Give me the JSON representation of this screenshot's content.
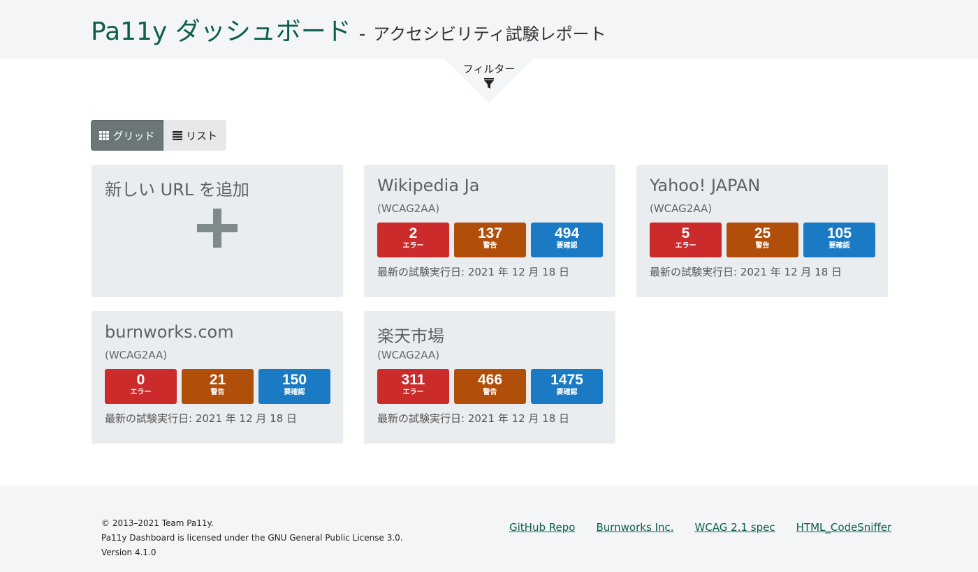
{
  "header": {
    "title": "Pa11y ダッシュボード",
    "separator": "-",
    "subtitle": "アクセシビリティ試験レポート"
  },
  "filter": {
    "label": "フィルター",
    "icon": "filter-icon"
  },
  "view_toggle": {
    "grid_label": "グリッド",
    "list_label": "リスト",
    "active": "grid"
  },
  "add_card": {
    "title": "新しい URL を追加",
    "icon": "plus-icon"
  },
  "stat_labels": {
    "errors": "エラー",
    "warnings": "警告",
    "notices": "要確認"
  },
  "sites": [
    {
      "name": "Wikipedia Ja",
      "standard": "(WCAG2AA)",
      "errors": "2",
      "warnings": "137",
      "notices": "494",
      "last_run": "最新の試験実行日: 2021 年 12 月 18 日"
    },
    {
      "name": "Yahoo! JAPAN",
      "standard": "(WCAG2AA)",
      "errors": "5",
      "warnings": "25",
      "notices": "105",
      "last_run": "最新の試験実行日: 2021 年 12 月 18 日"
    },
    {
      "name": "burnworks.com",
      "standard": "(WCAG2AA)",
      "errors": "0",
      "warnings": "21",
      "notices": "150",
      "last_run": "最新の試験実行日: 2021 年 12 月 18 日"
    },
    {
      "name": "楽天市場",
      "standard": "(WCAG2AA)",
      "errors": "311",
      "warnings": "466",
      "notices": "1475",
      "last_run": "最新の試験実行日: 2021 年 12 月 18 日"
    }
  ],
  "colors": {
    "error": "#cb2b2b",
    "warning": "#b04e0a",
    "notice": "#1a7ac3",
    "brand": "#0d5e4f"
  },
  "footer": {
    "copyright": "© 2013–2021 Team Pa11y.",
    "license": "Pa11y Dashboard is licensed under the GNU General Public License 3.0.",
    "version": "Version 4.1.0",
    "links": [
      "GitHub Repo",
      "Burnworks Inc.",
      "WCAG 2.1 spec",
      "HTML_CodeSniffer"
    ]
  }
}
